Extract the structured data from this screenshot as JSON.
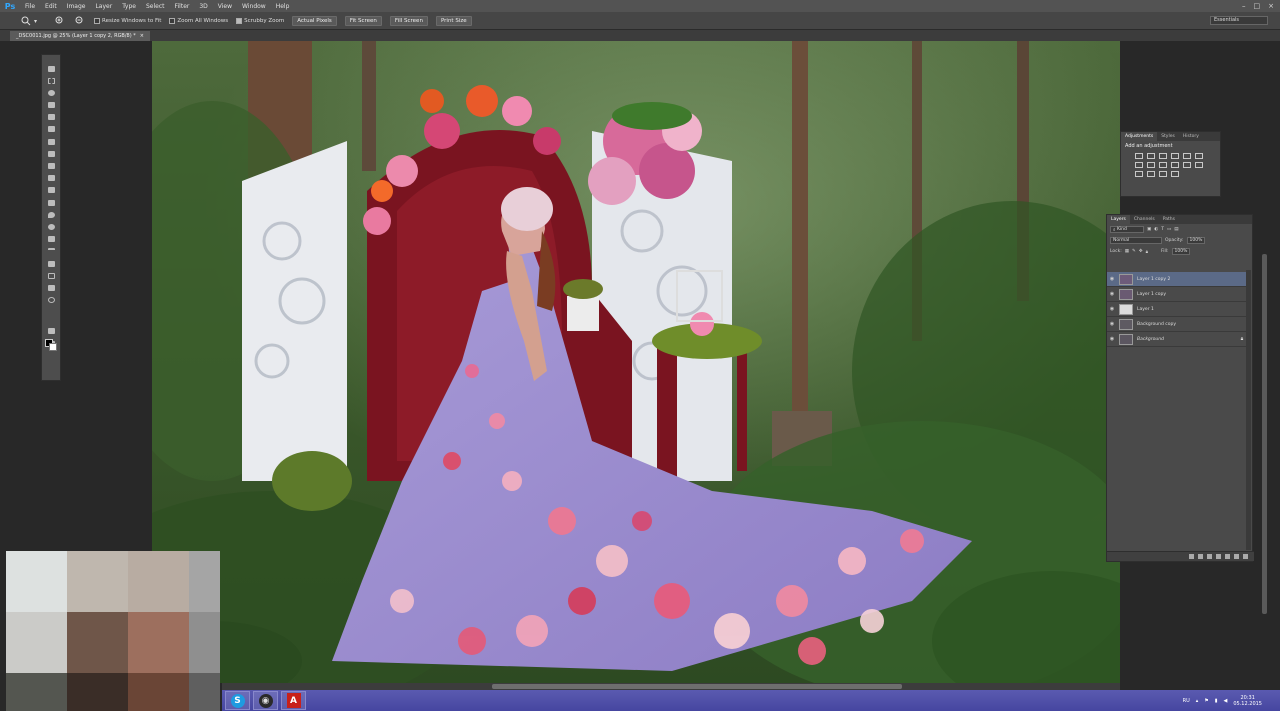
{
  "app": {
    "logo": "Ps"
  },
  "menu": [
    "File",
    "Edit",
    "Image",
    "Layer",
    "Type",
    "Select",
    "Filter",
    "3D",
    "View",
    "Window",
    "Help"
  ],
  "window_controls": [
    "–",
    "□",
    "×"
  ],
  "options_bar": {
    "checkboxes": [
      {
        "label": "Resize Windows to Fit",
        "checked": false
      },
      {
        "label": "Zoom All Windows",
        "checked": false
      },
      {
        "label": "Scrubby Zoom",
        "checked": true
      }
    ],
    "buttons": [
      "Actual Pixels",
      "Fit Screen",
      "Fill Screen",
      "Print Size"
    ],
    "workspace": "Essentials"
  },
  "document_tab": "_DSC0011.jpg @ 25% (Layer 1 copy 2, RGB/8) *",
  "adjustments_panel": {
    "tabs": [
      "Adjustments",
      "Styles",
      "History"
    ],
    "title": "Add an adjustment",
    "icon_count": 16
  },
  "layers_panel": {
    "tabs": [
      "Layers",
      "Channels",
      "Paths"
    ],
    "kind_label": "Kind",
    "blend_mode": "Normal",
    "opacity_label": "Opacity:",
    "opacity": "100%",
    "lock_label": "Lock:",
    "fill_label": "Fill:",
    "fill": "100%",
    "layers": [
      {
        "name": "Layer 1 copy 2",
        "selected": true,
        "locked": false
      },
      {
        "name": "Layer 1 copy",
        "selected": false,
        "locked": false
      },
      {
        "name": "Layer 1",
        "selected": false,
        "locked": false
      },
      {
        "name": "Background copy",
        "selected": false,
        "locked": false
      },
      {
        "name": "Background",
        "selected": false,
        "locked": true
      }
    ]
  },
  "taskbar": {
    "apps": [
      {
        "icon": "skype-icon",
        "glyph": "S",
        "color": "#1e9be0"
      },
      {
        "icon": "obs-icon",
        "glyph": "◉",
        "color": "#2a2a2a"
      },
      {
        "icon": "acrobat-icon",
        "glyph": "A",
        "color": "#c8201a"
      }
    ],
    "language": "RU",
    "time": "20:31",
    "date": "05.12.2015"
  },
  "pixelated_overlay_colors": [
    "#dde1e0",
    "#bfb7ae",
    "#b8aca2",
    "#a5a5a5",
    "#cbcbc8",
    "#6f5649",
    "#9d6f5e",
    "#8f8f8f",
    "#545650",
    "#3a2d27",
    "#6a4536",
    "#5f5f5f"
  ]
}
